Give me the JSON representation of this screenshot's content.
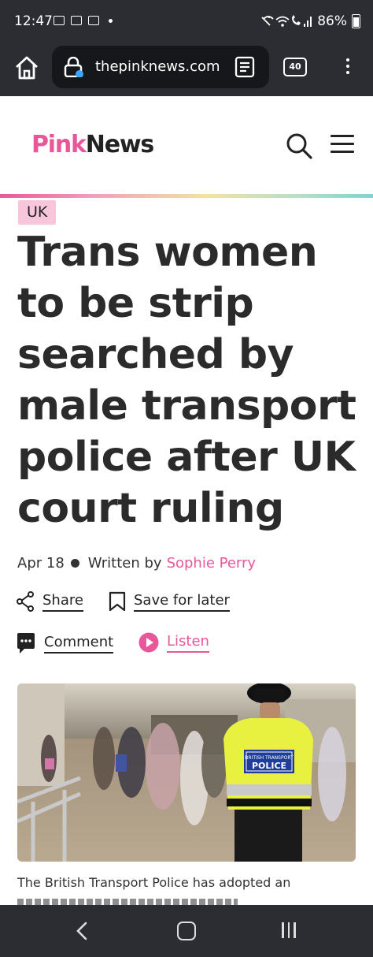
{
  "status_bar": {
    "time": "12:47",
    "battery": "86%"
  },
  "browser": {
    "url": "thepinknews.com",
    "tab_count": "40"
  },
  "site": {
    "logo_pink": "Pink",
    "logo_dark": "News",
    "brand_color": "#e8579a"
  },
  "article": {
    "tag": "UK",
    "headline_lines": [
      "Trans women",
      "to be strip",
      "searched by",
      "male transport",
      "police after UK",
      "court ruling"
    ],
    "date": "Apr 18",
    "written_by": "Written by",
    "author": "Sophie Perry",
    "actions": {
      "share": "Share",
      "save": "Save for later",
      "comment": "Comment",
      "listen": "Listen"
    },
    "image": {
      "vest_brand": "BRITISH TRANSPORT",
      "vest_label": "POLICE"
    },
    "intro": "The British Transport Police has adopted an"
  },
  "icons": {
    "home": "home-icon",
    "lock": "lock-icon",
    "reader": "reader-mode-icon",
    "menu": "more-vert-icon",
    "search": "search-icon",
    "hamburger": "hamburger-menu-icon",
    "share": "share-icon",
    "bookmark": "bookmark-icon",
    "comment": "comment-icon",
    "play": "play-icon"
  }
}
